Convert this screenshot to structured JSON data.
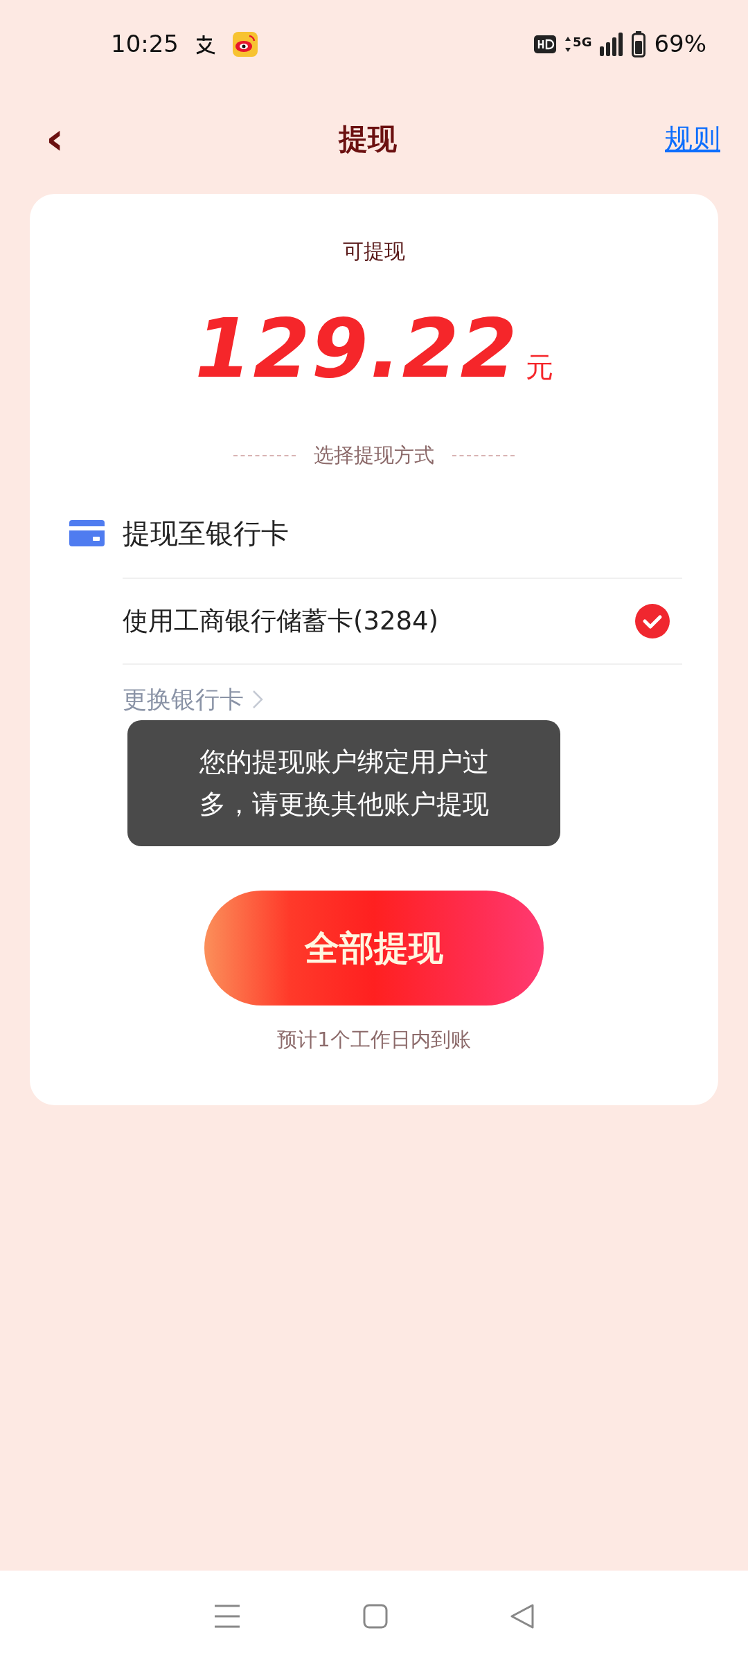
{
  "status_bar": {
    "time": "10:25",
    "battery": "69%",
    "network": "5G"
  },
  "nav": {
    "back": "‹",
    "title": "提现",
    "action": "规则"
  },
  "balance": {
    "label": "可提现",
    "amount": "129.22",
    "unit": "元"
  },
  "method_divider": "选择提现方式",
  "bank_section": {
    "title": "提现至银行卡",
    "options": [
      {
        "label": "使用工商银行储蓄卡(3284)",
        "selected": true
      }
    ],
    "change_link": "更换银行卡"
  },
  "toast": "您的提现账户绑定用户过多，请更换其他账户提现",
  "submit_button": "全部提现",
  "arrival_note": "预计1个工作日内到账"
}
